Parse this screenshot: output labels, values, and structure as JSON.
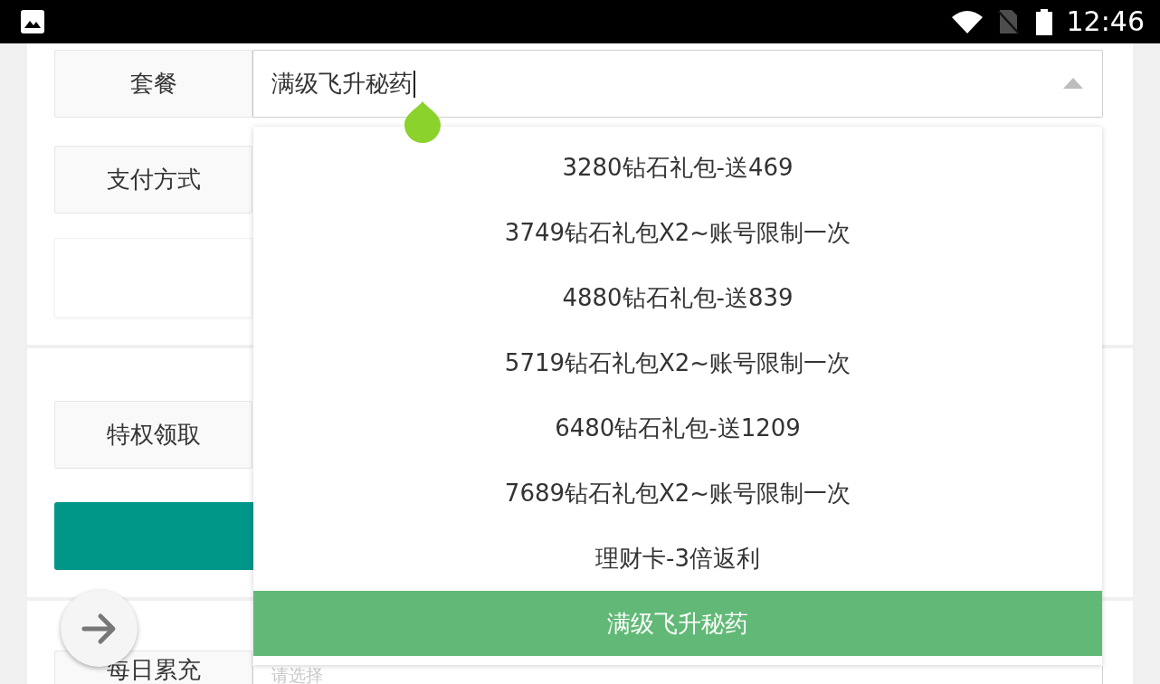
{
  "status_bar": {
    "time": "12:46"
  },
  "package_field": {
    "label": "套餐",
    "value": "满级飞升秘药",
    "expanded": true,
    "focused": true
  },
  "payment_field": {
    "label": "支付方式"
  },
  "privilege_field": {
    "label": "特权领取"
  },
  "daily_recharge_field": {
    "label": "每日累充",
    "placeholder": "请选择"
  },
  "package_options": [
    {
      "label": "3280钻石礼包-送469",
      "selected": false
    },
    {
      "label": "3749钻石礼包X2~账号限制一次",
      "selected": false
    },
    {
      "label": "4880钻石礼包-送839",
      "selected": false
    },
    {
      "label": "5719钻石礼包X2~账号限制一次",
      "selected": false
    },
    {
      "label": "6480钻石礼包-送1209",
      "selected": false
    },
    {
      "label": "7689钻石礼包X2~账号限制一次",
      "selected": false
    },
    {
      "label": "理财卡-3倍返利",
      "selected": false
    },
    {
      "label": "满级飞升秘药",
      "selected": true
    }
  ]
}
